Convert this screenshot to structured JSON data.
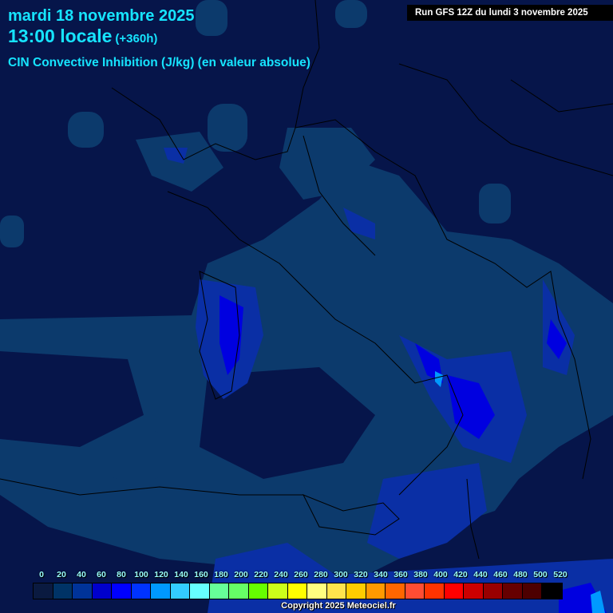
{
  "header": {
    "date": "mardi 18 novembre 2025",
    "time": "13:00 locale",
    "lead": "(+360h)",
    "parameter": "CIN Convective Inhibition (J/kg) (en valeur absolue)",
    "run": "Run GFS 12Z du lundi 3 novembre 2025"
  },
  "legend": {
    "labels": [
      "0",
      "20",
      "40",
      "60",
      "80",
      "100",
      "120",
      "140",
      "160",
      "180",
      "200",
      "220",
      "240",
      "260",
      "280",
      "300",
      "320",
      "340",
      "360",
      "380",
      "400",
      "420",
      "440",
      "460",
      "480",
      "500",
      "520"
    ],
    "colors": [
      "#0a1a40",
      "#003366",
      "#003399",
      "#0000cc",
      "#0000ff",
      "#0033ff",
      "#0099ff",
      "#33ccff",
      "#66ffff",
      "#66ff99",
      "#66ff66",
      "#66ff00",
      "#ccff1a",
      "#ffff00",
      "#ffff80",
      "#ffe34d",
      "#ffcc00",
      "#ff9900",
      "#ff6600",
      "#ff4d33",
      "#ff3300",
      "#ff0000",
      "#cc0000",
      "#990000",
      "#660000",
      "#4d0000",
      "#000000"
    ]
  },
  "copyright": "Copyright 2025 Meteociel.fr"
}
